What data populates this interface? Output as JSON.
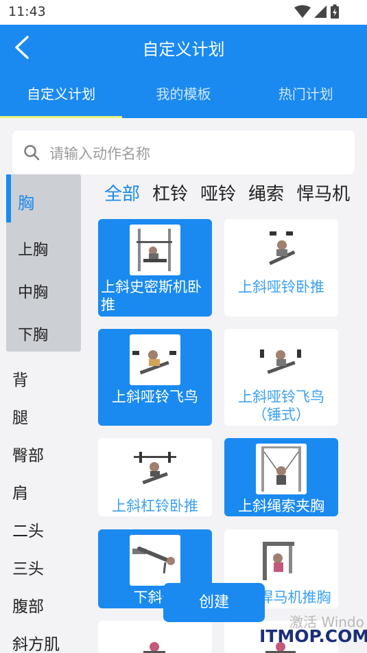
{
  "status": {
    "time": "11:43"
  },
  "header": {
    "title": "自定义计划"
  },
  "tabs": [
    {
      "label": "自定义计划"
    },
    {
      "label": "我的模板"
    },
    {
      "label": "热门计划"
    }
  ],
  "search": {
    "placeholder": "请输入动作名称"
  },
  "sidebar": {
    "chest": "胸",
    "chest_subs": [
      "上胸",
      "中胸",
      "下胸"
    ],
    "items": [
      "背",
      "腿",
      "臀部",
      "肩",
      "二头",
      "三头",
      "腹部",
      "斜方肌"
    ]
  },
  "filters": [
    "全部",
    "杠铃",
    "哑铃",
    "绳索",
    "悍马机"
  ],
  "cards": [
    {
      "label": "上斜史密斯机卧推",
      "selected": true
    },
    {
      "label": "上斜哑铃卧推",
      "selected": false
    },
    {
      "label": "上斜哑铃飞鸟",
      "selected": true
    },
    {
      "label": "上斜哑铃飞鸟（锤式）",
      "selected": false
    },
    {
      "label": "上斜杠铃卧推",
      "selected": false
    },
    {
      "label": "上斜绳索夹胸",
      "selected": true
    },
    {
      "label": "下斜俯",
      "selected": true
    },
    {
      "label": "悍马机推胸",
      "selected": false
    }
  ],
  "create_button": "创建",
  "watermark": {
    "line1": "激活 Windo",
    "line2": "ITMOP.COM"
  },
  "colors": {
    "primary": "#1a8af0",
    "tab_indicator": "#e7f37a",
    "sidebar_group": "#cccfd4"
  }
}
